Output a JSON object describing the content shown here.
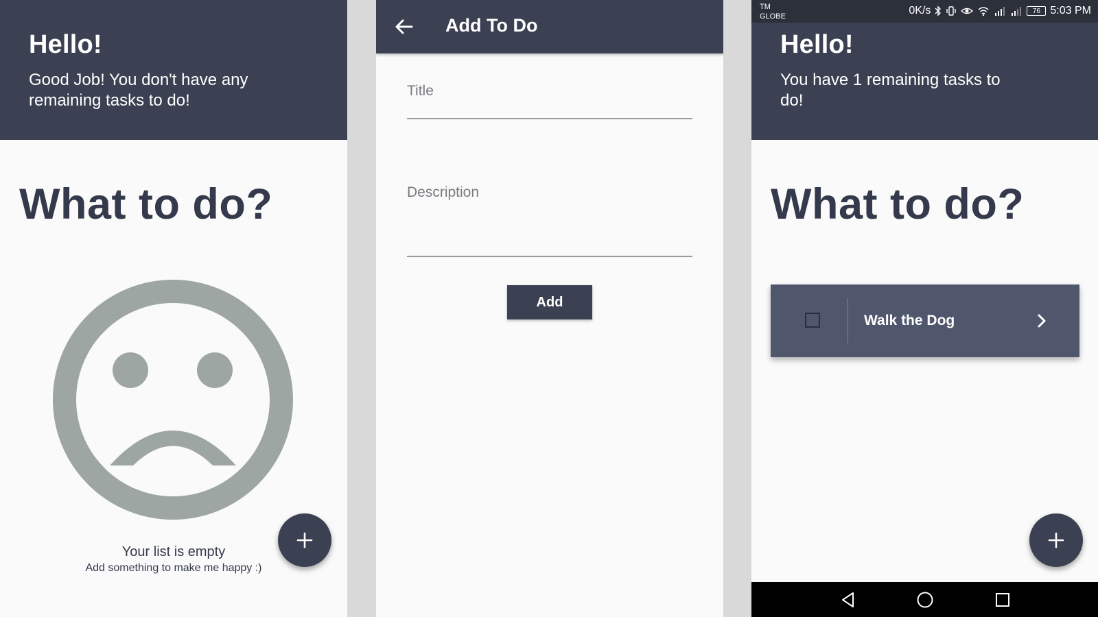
{
  "empty_screen": {
    "greeting": "Hello!",
    "message": "Good Job! You don't have any remaining tasks to do!",
    "heading": "What to do?",
    "empty_title": "Your list is empty",
    "empty_subtitle": "Add something to make me happy :)",
    "fab_icon": "plus-icon",
    "illustration": "sad-face-icon"
  },
  "add_screen": {
    "title": "Add To Do",
    "back_icon": "arrow-left-icon",
    "title_field": {
      "label": "Title",
      "value": ""
    },
    "description_field": {
      "label": "Description",
      "value": ""
    },
    "add_label": "Add"
  },
  "list_screen": {
    "status_bar": {
      "carrier_line1": "TM",
      "carrier_line2": "GLOBE",
      "speed": "0K/s",
      "battery": "76",
      "time": "5:03 PM"
    },
    "greeting": "Hello!",
    "message": "You have 1 remaining tasks to do!",
    "heading": "What to do?",
    "todos": [
      {
        "title": "Walk the Dog",
        "checked": false
      }
    ],
    "fab_icon": "plus-icon",
    "nav": [
      "back-triangle-icon",
      "home-circle-icon",
      "recents-square-icon"
    ]
  },
  "colors": {
    "primary": "#3b4152",
    "card": "#50566c",
    "heading_text": "#343a4c",
    "illustration": "#9ea6a4",
    "background": "#fafafa",
    "gutter": "#d9d9d9"
  }
}
